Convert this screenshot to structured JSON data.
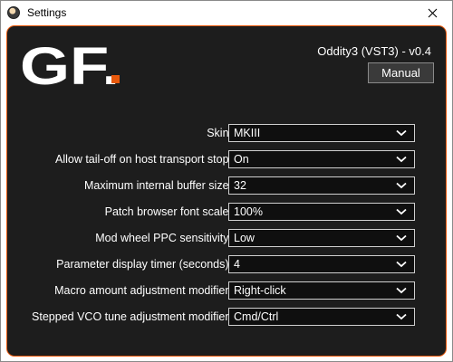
{
  "window": {
    "title": "Settings"
  },
  "header": {
    "logo_text": "GF.",
    "plugin_name": "Oddity3 (VST3) - v0.4",
    "manual_label": "Manual"
  },
  "settings": [
    {
      "label": "Skin:",
      "value": "MKIII"
    },
    {
      "label": "Allow tail-off on host transport stop:",
      "value": "On"
    },
    {
      "label": "Maximum internal buffer size:",
      "value": "32"
    },
    {
      "label": "Patch browser font scale:",
      "value": "100%"
    },
    {
      "label": "Mod wheel PPC sensitivity:",
      "value": "Low"
    },
    {
      "label": "Parameter display timer (seconds):",
      "value": "4"
    },
    {
      "label": "Macro amount adjustment modifier:",
      "value": "Right-click"
    },
    {
      "label": "Stepped VCO tune adjustment modifier:",
      "value": "Cmd/Ctrl"
    }
  ],
  "colors": {
    "accent": "#e8590c",
    "panel_bg": "#1d1d1d",
    "text": "#ffffff"
  },
  "icons": {
    "close": "close-icon",
    "dropdown": "chevron-down-icon",
    "app": "app-icon"
  }
}
